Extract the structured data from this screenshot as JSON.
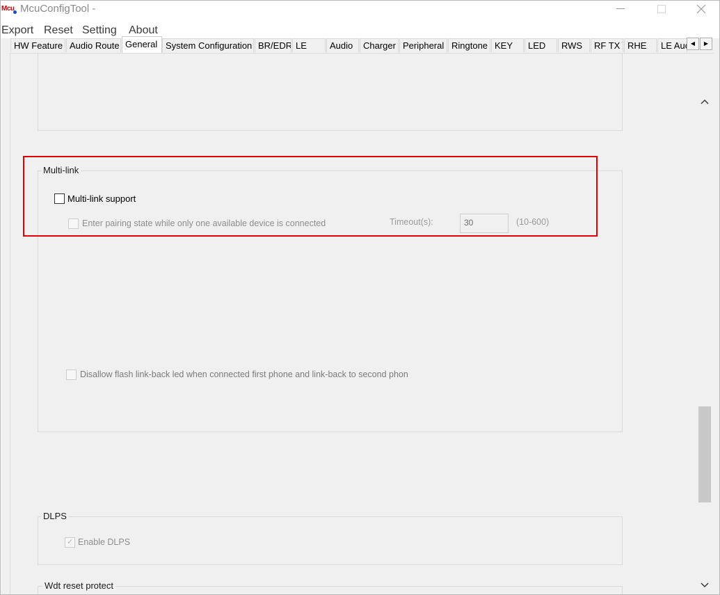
{
  "window": {
    "icon_text": "Mcu",
    "title": "McuConfigTool -"
  },
  "menu": [
    "Export",
    "Reset",
    "Setting",
    "About"
  ],
  "tabs": [
    "HW Feature",
    "Audio Route",
    "General",
    "System Configuration",
    "BR/EDR",
    "LE",
    "Audio",
    "Charger",
    "Peripheral",
    "Ringtone",
    "KEY",
    "LED",
    "RWS",
    "RF TX",
    "RHE",
    "LE Auc"
  ],
  "active_tab": "General",
  "multilink": {
    "group_title": "Multi-link",
    "support_label": "Multi-link support",
    "support_checked": false,
    "pairing_label": "Enter pairing state while only one available device is connected",
    "pairing_checked": false,
    "timeout_label": "Timeout(s):",
    "timeout_value": "30",
    "timeout_range": "(10-600)",
    "disallow_label": "Disallow flash link-back led when connected first phone and link-back to second phon",
    "disallow_checked": false
  },
  "dlps": {
    "group_title": "DLPS",
    "enable_label": "Enable DLPS",
    "enable_checked": true
  },
  "wdt": {
    "group_title": "Wdt reset protect"
  },
  "colors": {
    "highlight": "#e00000",
    "panel_bg": "#f0f0f0",
    "icon_red": "#d40000"
  }
}
